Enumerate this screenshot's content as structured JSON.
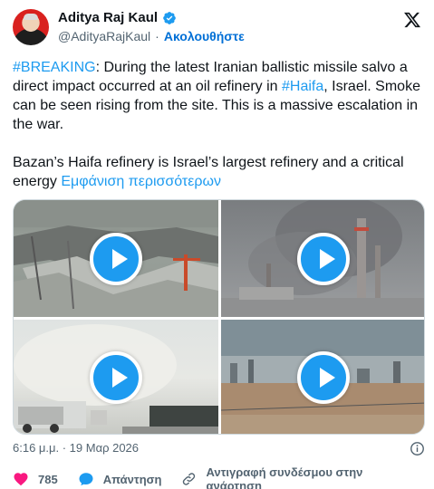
{
  "author": {
    "display_name": "Aditya Raj Kaul",
    "handle": "@AdityaRajKaul",
    "follow_label": "Ακολουθήστε",
    "verified_color": "#1d9bf0"
  },
  "tweet": {
    "hashtag_breaking": "#BREAKING",
    "text_1a": ": During the latest Iranian ballistic missile salvo a direct impact occurred at an oil refinery in ",
    "hashtag_haifa": "#Haifa",
    "text_1b": ", Israel. Smoke can be seen rising from the site. This is a massive escalation in the war.",
    "text_2": "Bazan’s Haifa refinery is Israel’s largest refinery and a critical energy ",
    "show_more": "Εμφάνιση περισσότερων"
  },
  "media": {
    "videos": [
      {
        "icon": "play-icon"
      },
      {
        "icon": "play-icon"
      },
      {
        "icon": "play-icon"
      },
      {
        "icon": "play-icon"
      }
    ]
  },
  "meta": {
    "timestamp": "6:16 μ.μ. · 19 Μαρ 2026"
  },
  "actions": {
    "likes": "785",
    "reply_label": "Απάντηση",
    "copy_link_label": "Αντιγραφή συνδέσμου στην ανάρτηση"
  },
  "colors": {
    "accent": "#1d9bf0",
    "like": "#f91880",
    "text": "#0f1419",
    "secondary": "#536471"
  }
}
